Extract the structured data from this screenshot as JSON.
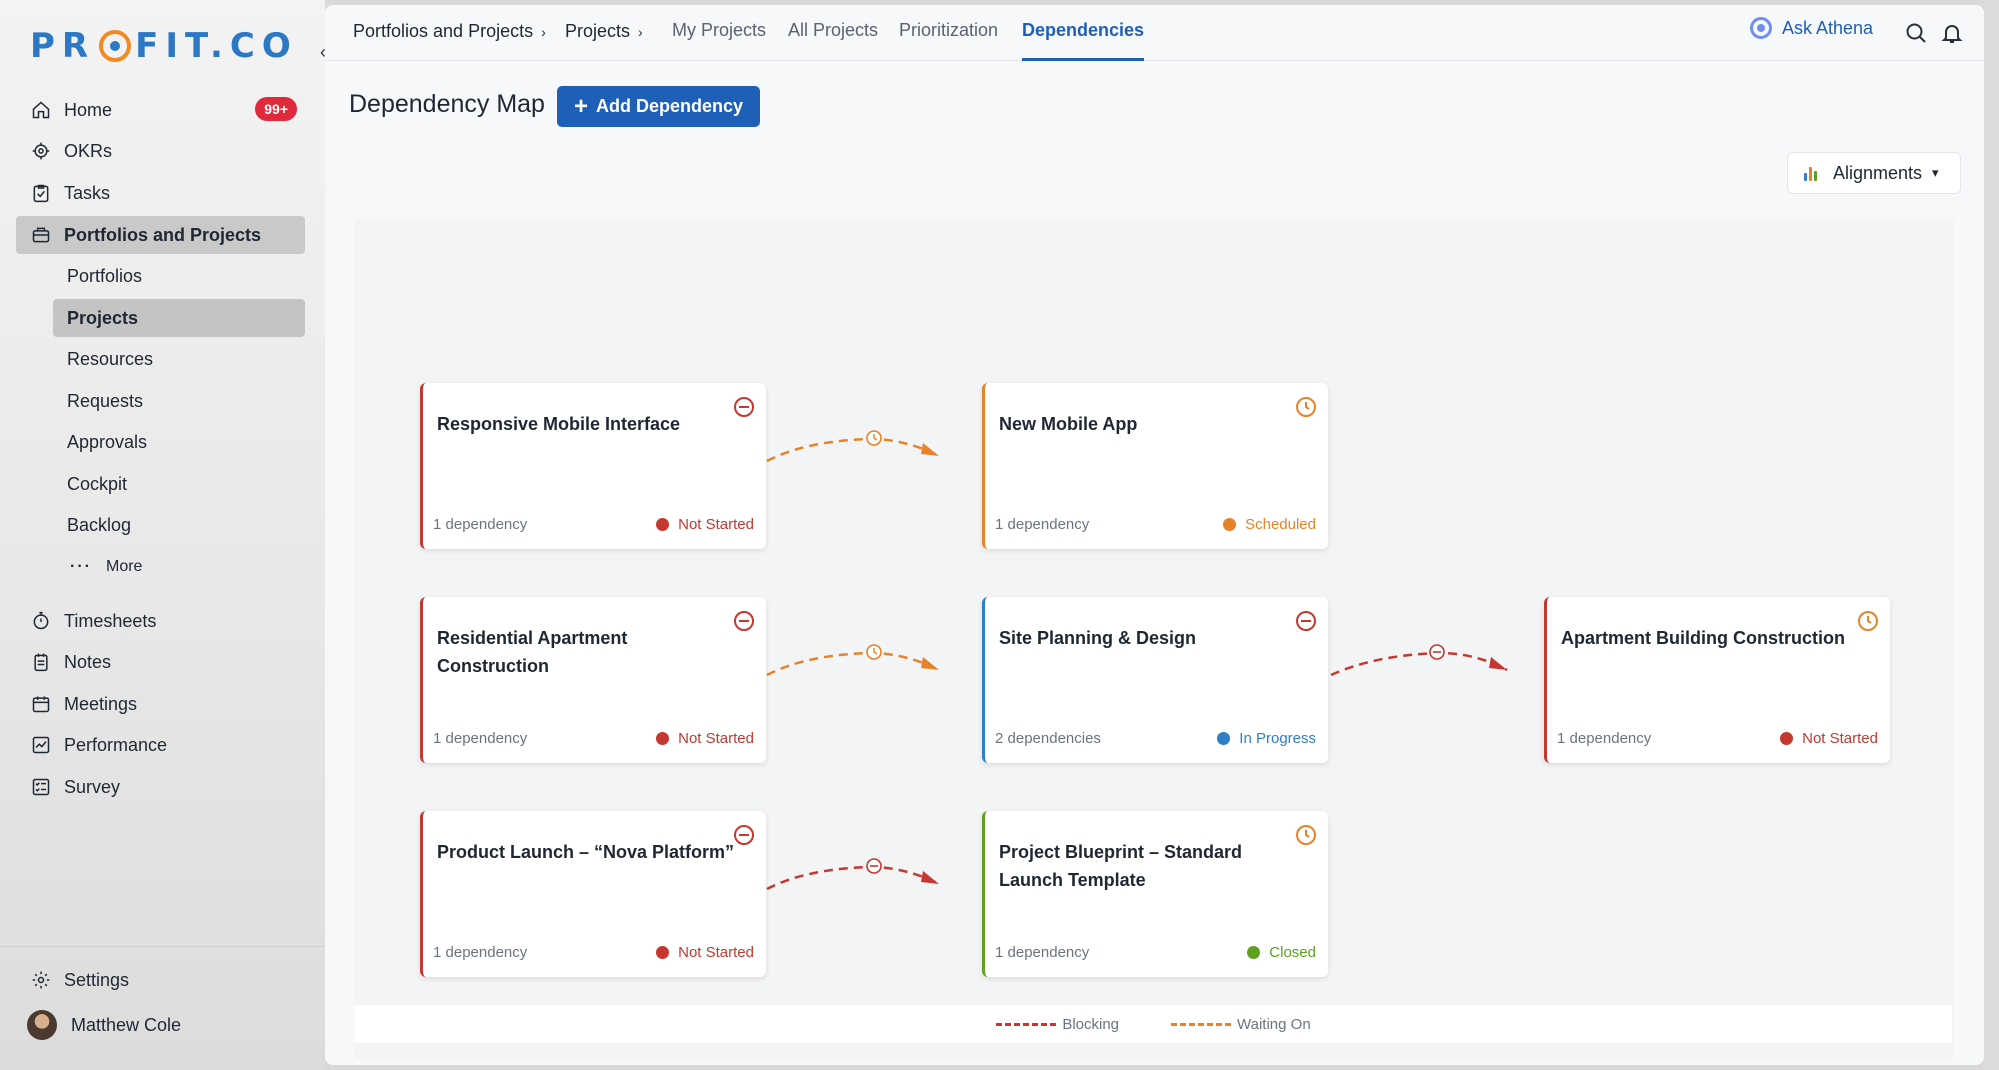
{
  "brand": {
    "logo_left": "PR",
    "logo_right": "FIT.CO"
  },
  "sidebar": {
    "items": [
      {
        "label": "Home",
        "badge": "99+",
        "icon": "home-icon"
      },
      {
        "label": "OKRs",
        "icon": "target-icon"
      },
      {
        "label": "Tasks",
        "icon": "clipboard-check-icon"
      },
      {
        "label": "Portfolios and Projects",
        "icon": "briefcase-icon"
      }
    ],
    "sub_items": [
      "Portfolios",
      "Projects",
      "Resources",
      "Requests",
      "Approvals",
      "Cockpit",
      "Backlog",
      "More"
    ],
    "more_dots": "···",
    "items2": [
      {
        "label": "Timesheets",
        "icon": "stopwatch-icon"
      },
      {
        "label": "Notes",
        "icon": "notepad-icon"
      },
      {
        "label": "Meetings",
        "icon": "calendar-icon"
      },
      {
        "label": "Performance",
        "icon": "chart-line-icon"
      },
      {
        "label": "Survey",
        "icon": "checklist-icon"
      }
    ],
    "settings": "Settings",
    "user": "Matthew Cole"
  },
  "topbar": {
    "breadcrumbs": [
      "Portfolios and Projects",
      "Projects"
    ],
    "crumb_sep": "›",
    "tabs": [
      "My Projects",
      "All Projects",
      "Prioritization",
      "Dependencies"
    ],
    "active_tab": "Dependencies",
    "ask": "Ask Athena"
  },
  "page": {
    "title": "Dependency Map",
    "add_button": "Add Dependency",
    "alignments": "Alignments"
  },
  "cards": [
    {
      "title": "Responsive Mobile Interface",
      "deps": "1 dependency",
      "status": "Not Started",
      "status_color": "#c5372f",
      "icon": "minus-circle-icon"
    },
    {
      "title": "New Mobile App",
      "deps": "1 dependency",
      "status": "Scheduled",
      "status_color": "#e8822a",
      "icon": "clock-icon"
    },
    {
      "title": "Residential Apartment Construction",
      "deps": "1 dependency",
      "status": "Not Started",
      "status_color": "#c5372f",
      "icon": "minus-circle-icon"
    },
    {
      "title": "Site Planning & Design",
      "deps": "2 dependencies",
      "status": "In Progress",
      "status_color": "#2e7fc9",
      "icon": "minus-circle-icon"
    },
    {
      "title": "Apartment Building Construction",
      "deps": "1 dependency",
      "status": "Not Started",
      "status_color": "#c5372f",
      "icon": "clock-icon"
    },
    {
      "title": "Product Launch – “Nova Platform”",
      "deps": "1 dependency",
      "status": "Not Started",
      "status_color": "#c5372f",
      "icon": "minus-circle-icon"
    },
    {
      "title": "Project Blueprint – Standard Launch Template",
      "deps": "1 dependency",
      "status": "Closed",
      "status_color": "#5ea11e",
      "icon": "clock-icon"
    }
  ],
  "legend": [
    {
      "label": "Blocking",
      "color": "#c5372f"
    },
    {
      "label": "Waiting On",
      "color": "#e8822a"
    }
  ],
  "colors": {
    "accent": "#1e5fb8",
    "blocking": "#c5372f",
    "waiting": "#e8822a",
    "badge": "#e02a3c",
    "closed": "#5ea11e",
    "in_progress": "#2e7fc9"
  }
}
